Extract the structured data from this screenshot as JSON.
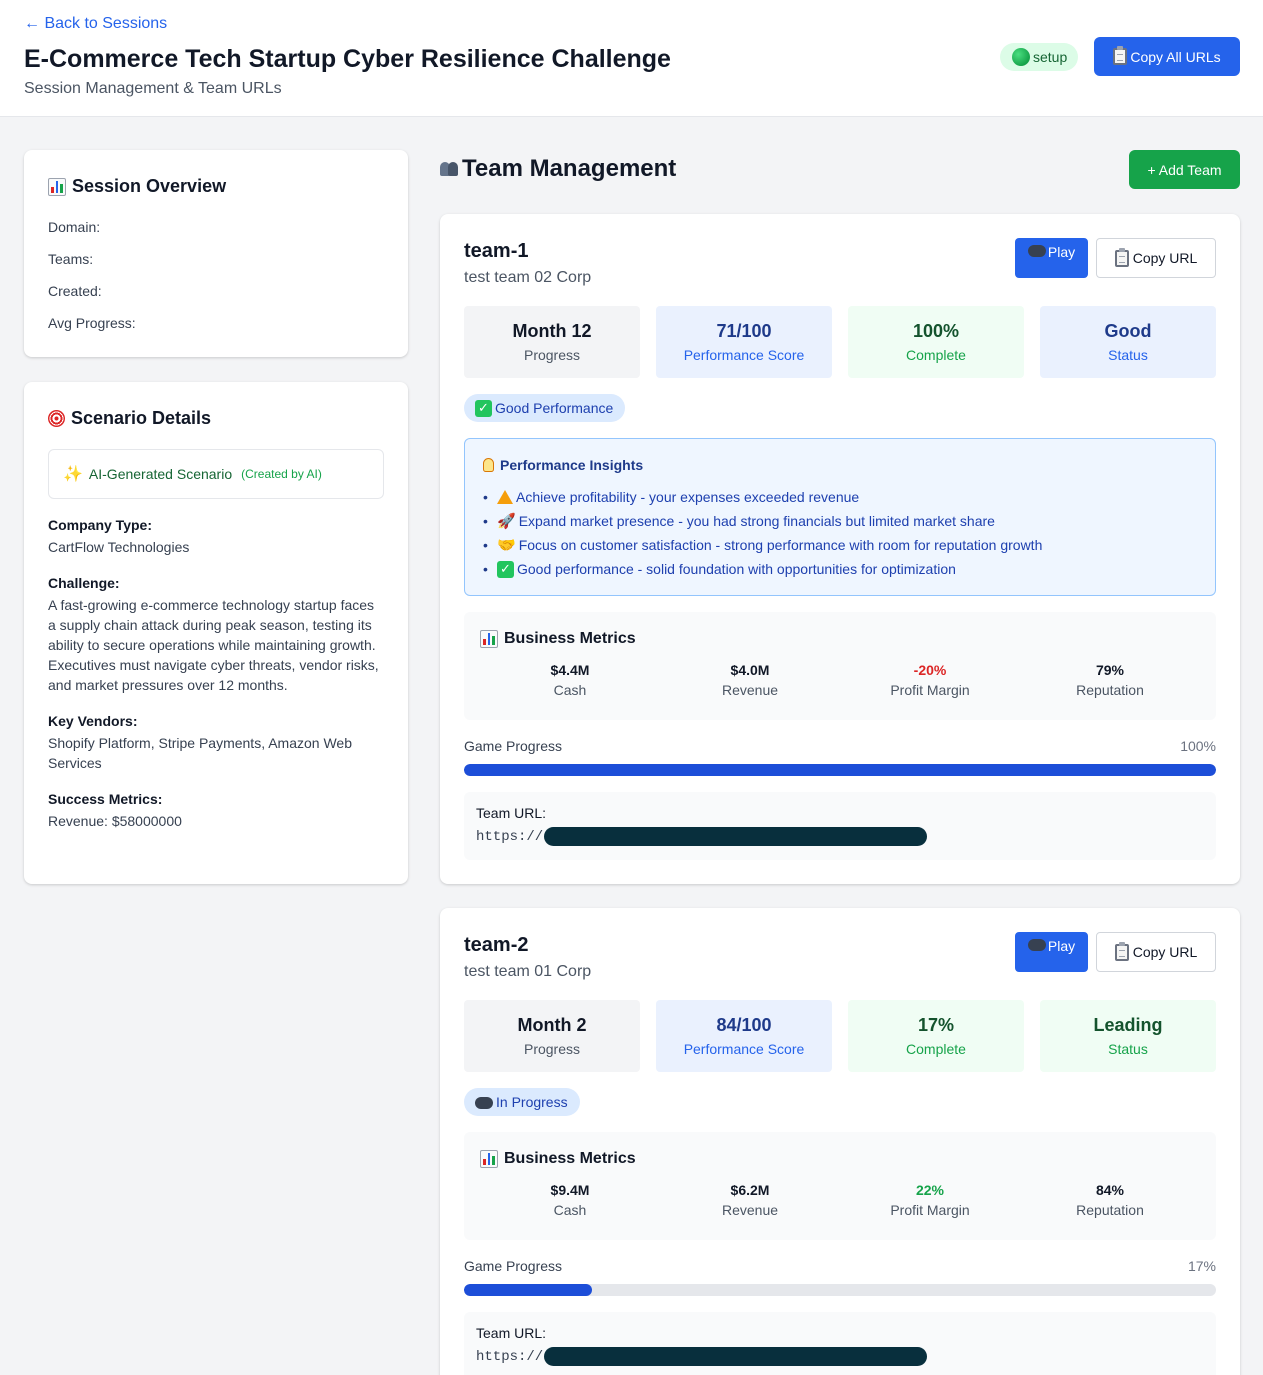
{
  "header": {
    "back_label": "← Back to Sessions",
    "title": "E-Commerce Tech Startup Cyber Resilience Challenge",
    "subtitle": "Session Management & Team URLs",
    "status": "setup",
    "copy_all_label": "Copy All URLs"
  },
  "overview": {
    "title": "Session Overview",
    "rows": [
      "Domain:",
      "Teams:",
      "Created:",
      "Avg Progress:"
    ]
  },
  "scenario": {
    "title": "Scenario Details",
    "ai_label": "AI-Generated Scenario",
    "ai_by": "(Created by AI)",
    "company_type_label": "Company Type:",
    "company_type": "CartFlow Technologies",
    "challenge_label": "Challenge:",
    "challenge": "A fast-growing e-commerce technology startup faces a supply chain attack during peak season, testing its ability to secure operations while maintaining growth. Executives must navigate cyber threats, vendor risks, and market pressures over 12 months.",
    "vendors_label": "Key Vendors:",
    "vendors": "Shopify Platform, Stripe Payments, Amazon Web Services",
    "success_label": "Success Metrics:",
    "success": "Revenue: $58000000"
  },
  "team_management": {
    "title": "Team Management",
    "add_label": "+ Add Team"
  },
  "teams": [
    {
      "name": "team-1",
      "corp": "test team 02 Corp",
      "play_label": "Play",
      "copy_label": "Copy URL",
      "month": "Month 12",
      "month_sub": "Progress",
      "score": "71/100",
      "score_sub": "Performance Score",
      "complete": "100%",
      "complete_sub": "Complete",
      "status": "Good",
      "status_sub": "Status",
      "status_color": "blue",
      "pill": "Good Performance",
      "insights_title": "Performance Insights",
      "insights": [
        "Achieve profitability - your expenses exceeded revenue",
        "Expand market presence - you had strong financials but limited market share",
        "Focus on customer satisfaction - strong performance with room for reputation growth",
        "Good performance - solid foundation with opportunities for optimization"
      ],
      "metrics_title": "Business Metrics",
      "metrics": [
        {
          "value": "$4.4M",
          "label": "Cash"
        },
        {
          "value": "$4.0M",
          "label": "Revenue"
        },
        {
          "value": "-20%",
          "label": "Profit Margin"
        },
        {
          "value": "79%",
          "label": "Reputation"
        }
      ],
      "progress_label": "Game Progress",
      "progress_text": "100%",
      "progress": 1.0,
      "url_label": "Team URL:",
      "url_prefix": "https://"
    },
    {
      "name": "team-2",
      "corp": "test team 01 Corp",
      "play_label": "Play",
      "copy_label": "Copy URL",
      "month": "Month 2",
      "month_sub": "Progress",
      "score": "84/100",
      "score_sub": "Performance Score",
      "complete": "17%",
      "complete_sub": "Complete",
      "status": "Leading",
      "status_sub": "Status",
      "status_color": "green",
      "pill": "In Progress",
      "metrics_title": "Business Metrics",
      "metrics": [
        {
          "value": "$9.4M",
          "label": "Cash"
        },
        {
          "value": "$6.2M",
          "label": "Revenue"
        },
        {
          "value": "22%",
          "label": "Profit Margin"
        },
        {
          "value": "84%",
          "label": "Reputation"
        }
      ],
      "progress_label": "Game Progress",
      "progress_text": "17%",
      "progress": 0.17,
      "url_label": "Team URL:",
      "url_prefix": "https://"
    }
  ],
  "colors": {
    "primary": "#2563eb",
    "success": "#16a34a",
    "danger": "#dc2626",
    "progress": "#1d4ed8"
  }
}
